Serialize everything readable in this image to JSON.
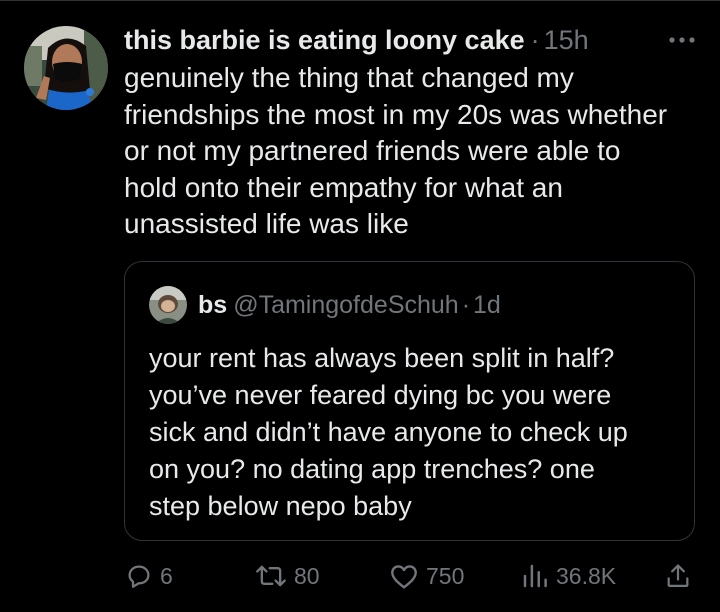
{
  "tweet": {
    "display_name": "this barbie is eating loony cake",
    "separator": "·",
    "time": "15h",
    "text": "genuinely the thing that changed my\nfriendships the most in my 20s was whether\nor not my partnered friends were able to\nhold onto their empathy for what an\nunassisted life was like",
    "avatar_icon": "user-photo-avatar",
    "more_icon": "more-horizontal-icon"
  },
  "quote": {
    "display_name": "bs",
    "handle": "@TamingofdeSchuh",
    "separator": "·",
    "time": "1d",
    "text": "your rent has always been split in half?\nyou’ve never feared dying bc you were\nsick and didn’t have anyone to check up\non you? no dating app trenches? one\nstep below nepo baby",
    "avatar_icon": "user-photo-avatar"
  },
  "actions": {
    "replies": "6",
    "retweets": "80",
    "likes": "750",
    "views": "36.8K",
    "icons": [
      "reply-icon",
      "retweet-icon",
      "like-icon",
      "views-icon",
      "share-icon"
    ]
  },
  "colors": {
    "background": "#000000",
    "primary_text": "#e7e9ea",
    "secondary_text": "#71767b",
    "border": "#2f3336"
  }
}
